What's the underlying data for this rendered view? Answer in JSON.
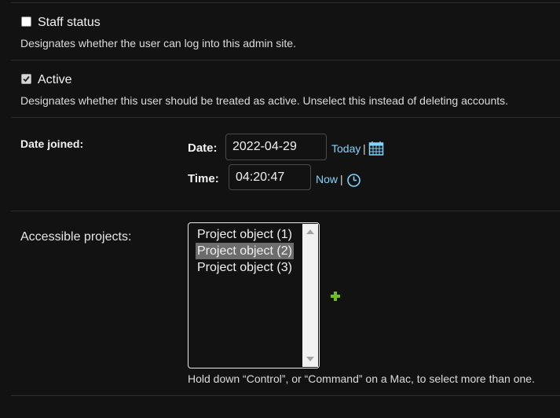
{
  "staff_status": {
    "label": "Staff status",
    "checked": false,
    "help": "Designates whether the user can log into this admin site."
  },
  "active": {
    "label": "Active",
    "checked": true,
    "help": "Designates whether this user should be treated as active. Unselect this instead of deleting accounts."
  },
  "date_joined": {
    "label": "Date joined:",
    "date_label": "Date:",
    "date_value": "2022-04-29",
    "today_link": "Today",
    "time_label": "Time:",
    "time_value": "04:20:47",
    "now_link": "Now",
    "separator": "|",
    "calendar_icon": "calendar-icon",
    "clock_icon": "clock-icon"
  },
  "accessible_projects": {
    "label": "Accessible projects:",
    "options": [
      "Project object (1)",
      "Project object (2)",
      "Project object (3)"
    ],
    "selected_index": 1,
    "add_icon": "plus-icon",
    "help": "Hold down “Control”, or “Command” on a Mac, to select more than one."
  },
  "colors": {
    "background": "#121212",
    "link": "#81d4fa",
    "add": "#6cbf1f",
    "separator": "#2e2e2e",
    "selected_option": "#6d6d6d"
  }
}
